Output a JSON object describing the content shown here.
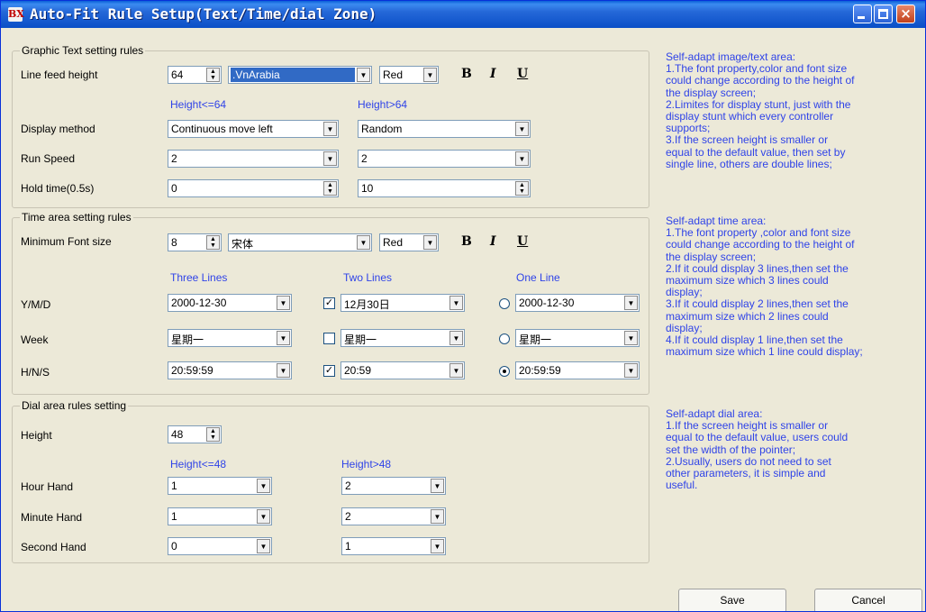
{
  "window": {
    "title": "Auto-Fit Rule Setup(Text/Time/dial Zone)",
    "logo": "BX"
  },
  "text_rules": {
    "legend": "Graphic Text setting rules",
    "line_feed_label": "Line feed height",
    "line_feed_value": "64",
    "font_value": ".VnArabia",
    "color_value": "Red",
    "bold": "B",
    "italic": "I",
    "underline": "U",
    "col_low": "Height<=64",
    "col_high": "Height>64",
    "display_label": "Display method",
    "display_low": "Continuous move left",
    "display_high": "Random",
    "speed_label": "Run Speed",
    "speed_low": "2",
    "speed_high": "2",
    "hold_label": "Hold time(0.5s)",
    "hold_low": "0",
    "hold_high": "10"
  },
  "time_rules": {
    "legend": "Time area setting rules",
    "min_font_label": "Minimum Font size",
    "min_font_value": "8",
    "font_value": "宋体",
    "color_value": "Red",
    "bold": "B",
    "italic": "I",
    "underline": "U",
    "col_three": "Three Lines",
    "col_two": "Two Lines",
    "col_one": "One Line",
    "ymd_label": "Y/M/D",
    "ymd_three": "2000-12-30",
    "ymd_two": "12月30日",
    "ymd_one": "2000-12-30",
    "week_label": "Week",
    "week_three": "星期一",
    "week_two": "星期一",
    "week_one": "星期一",
    "hns_label": "H/N/S",
    "hns_three": "20:59:59",
    "hns_two": "20:59",
    "hns_one": "20:59:59"
  },
  "dial_rules": {
    "legend": "Dial area rules setting",
    "height_label": "Height",
    "height_value": "48",
    "col_low": "Height<=48",
    "col_high": "Height>48",
    "hour_label": "Hour Hand",
    "hour_low": "1",
    "hour_high": "2",
    "minute_label": "Minute Hand",
    "minute_low": "1",
    "minute_high": "2",
    "second_label": "Second Hand",
    "second_low": "0",
    "second_high": "1"
  },
  "info": {
    "text_area": [
      "Self-adapt image/text area:",
      "1.The font property,color and font size",
      "could change according to the height of",
      "the display screen;",
      "2.Limites for display stunt, just with the",
      "display stunt which every controller",
      "supports;",
      "3.If the screen height is smaller or",
      "equal to the default value, then set by",
      "single line, others are double lines;"
    ],
    "time_area": [
      "Self-adapt time area:",
      "1.The font property ,color and font size",
      "could change according to the height of",
      "the display screen;",
      "2.If it could display 3 lines,then set the",
      "maximum size which 3 lines could",
      "display;",
      "3.If it could display 2 lines,then set the",
      "maximum size which 2 lines could",
      "display;",
      "4.If it could display 1 line,then set the",
      "maximum size which 1 line could display;"
    ],
    "dial_area": [
      "Self-adapt dial area:",
      "1.If the screen height is smaller or",
      "equal to the default value, users could",
      "set the width of the pointer;",
      "2.Usually, users do not need to set",
      "other parameters, it is simple and",
      "useful."
    ]
  },
  "buttons": {
    "save": "Save",
    "cancel": "Cancel"
  }
}
